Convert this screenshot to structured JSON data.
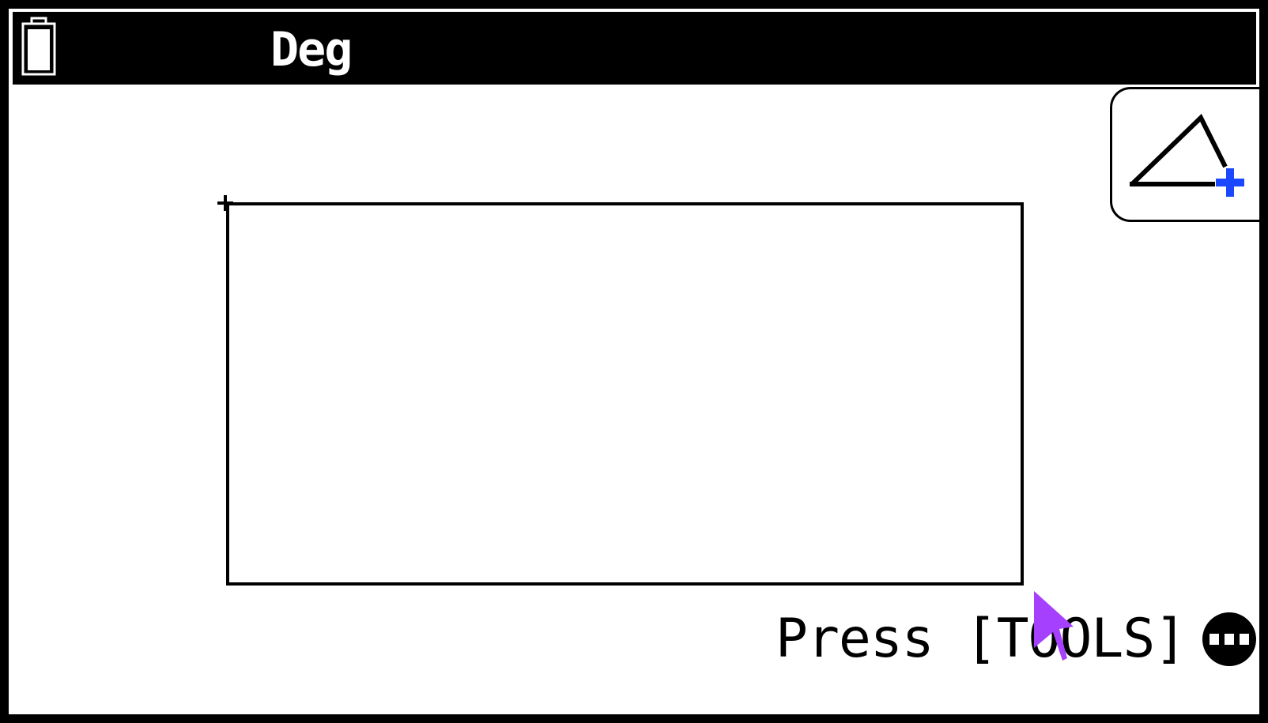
{
  "status_bar": {
    "angle_mode": "Deg",
    "battery_icon": "battery-icon"
  },
  "toolbar": {
    "shape_button_icon": "triangle-plus-icon"
  },
  "canvas": {
    "selection_rect_icon": "selection-rectangle"
  },
  "hint": {
    "text": "Press [TOOLS]",
    "icon": "more-dots-icon"
  },
  "cursor": {
    "icon": "mouse-pointer-icon"
  },
  "colors": {
    "background": "#ffffff",
    "foreground": "#000000",
    "accent_plus": "#1a47ff",
    "cursor": "#a640ff"
  }
}
